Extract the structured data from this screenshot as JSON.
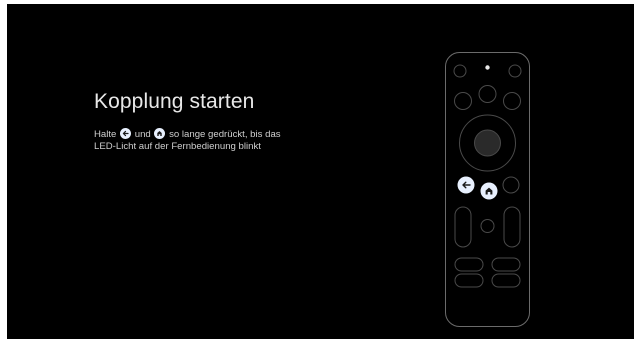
{
  "screen": {
    "title": "Kopplung starten",
    "instruction": {
      "prefix": "Halte",
      "back_icon": "back-arrow-icon",
      "connector": "und",
      "home_icon": "home-icon",
      "suffix": "so lange gedrückt, bis das",
      "line2": "LED-Licht auf der Fernbedienung blinkt"
    }
  },
  "remote": {
    "highlighted_buttons": [
      "back-button",
      "home-button"
    ],
    "highlight_color": "#e8f0fe"
  },
  "colors": {
    "background": "#000000",
    "text": "#e8e8e8",
    "remote_outline": "#5f6368"
  }
}
